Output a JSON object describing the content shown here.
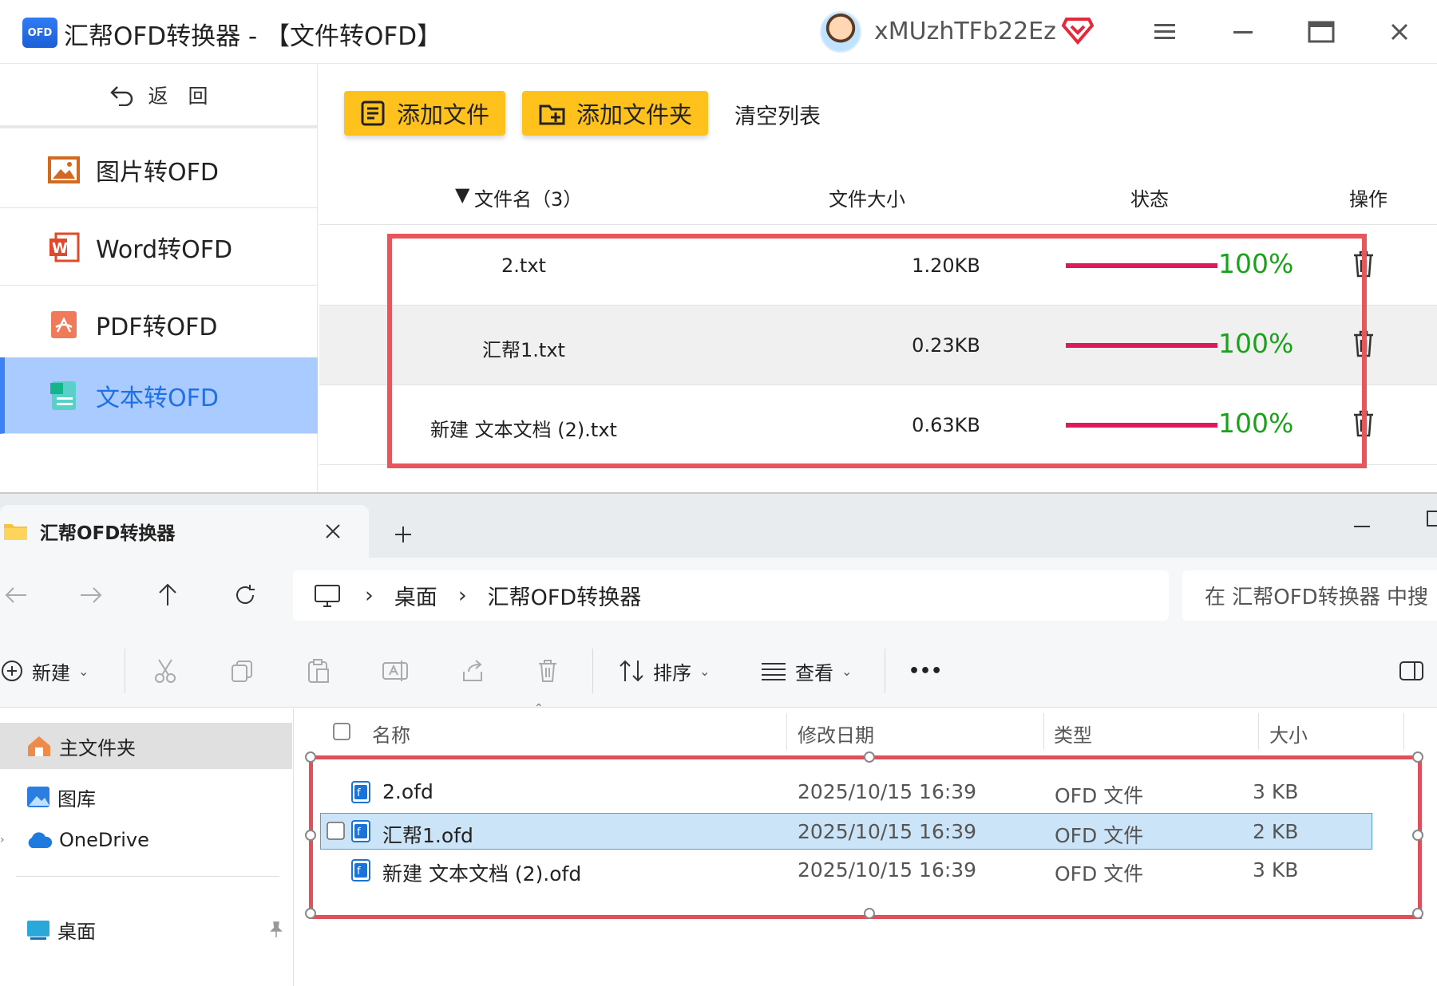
{
  "app": {
    "logo_text": "OFD",
    "title": "汇帮OFD转换器 - 【文件转OFD】",
    "username": "xMUzhTFb22Ez",
    "accent": "#ffc21c",
    "back_label": "返　回",
    "sidebar": [
      {
        "label": "图片转OFD",
        "icon": "image-icon"
      },
      {
        "label": "Word转OFD",
        "icon": "word-icon"
      },
      {
        "label": "PDF转OFD",
        "icon": "pdf-icon"
      },
      {
        "label": "文本转OFD",
        "icon": "text-file-icon",
        "active": true
      }
    ],
    "buttons": {
      "add_file": "添加文件",
      "add_folder": "添加文件夹",
      "clear": "清空列表"
    },
    "table": {
      "headers": {
        "name": "文件名（3）",
        "size": "文件大小",
        "status": "状态",
        "action": "操作"
      },
      "rows": [
        {
          "name": "2.txt",
          "size": "1.20KB",
          "progress": 1.0,
          "percent": "100%"
        },
        {
          "name": "汇帮1.txt",
          "size": "0.23KB",
          "progress": 1.0,
          "percent": "100%"
        },
        {
          "name": "新建 文本文档 (2).txt",
          "size": "0.63KB",
          "progress": 1.0,
          "percent": "100%"
        }
      ]
    }
  },
  "explorer": {
    "tab_title": "汇帮OFD转换器",
    "path": [
      "桌面",
      "汇帮OFD转换器"
    ],
    "search_placeholder": "在 汇帮OFD转换器 中搜",
    "toolbar": {
      "new": "新建",
      "sort": "排序",
      "view": "查看",
      "more": "•••"
    },
    "nav": [
      {
        "label": "主文件夹",
        "icon": "home-icon"
      },
      {
        "label": "图库",
        "icon": "gallery-icon"
      },
      {
        "label": "OneDrive",
        "icon": "cloud-icon"
      },
      {
        "label": "桌面",
        "icon": "desktop-icon"
      }
    ],
    "columns": {
      "name": "名称",
      "date": "修改日期",
      "type": "类型",
      "size": "大小"
    },
    "files": [
      {
        "name": "2.ofd",
        "date": "2025/10/15 16:39",
        "type": "OFD 文件",
        "size": "3 KB"
      },
      {
        "name": "汇帮1.ofd",
        "date": "2025/10/15 16:39",
        "type": "OFD 文件",
        "size": "2 KB"
      },
      {
        "name": "新建 文本文档 (2).ofd",
        "date": "2025/10/15 16:39",
        "type": "OFD 文件",
        "size": "3 KB"
      }
    ]
  }
}
